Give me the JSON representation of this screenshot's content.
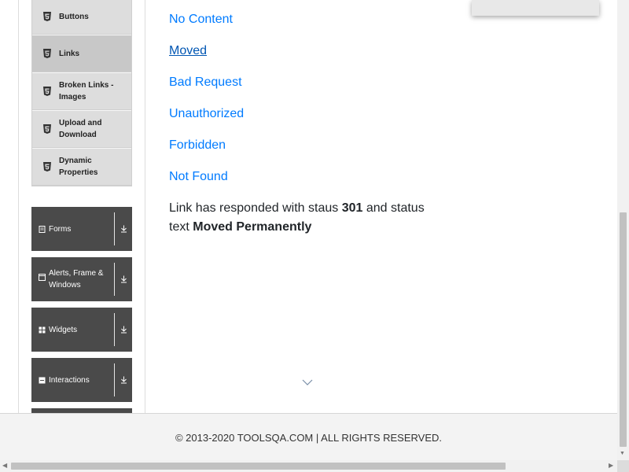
{
  "sidebar": {
    "elements_submenu": [
      {
        "label": "Buttons",
        "icon": "html5-icon",
        "active": false
      },
      {
        "label": "Links",
        "icon": "html5-icon",
        "active": true
      },
      {
        "label": "Broken Links - Images",
        "icon": "html5-icon",
        "active": false
      },
      {
        "label": "Upload and Download",
        "icon": "html5-icon",
        "active": false
      },
      {
        "label": "Dynamic Properties",
        "icon": "html5-icon",
        "active": false
      }
    ],
    "groups": [
      {
        "label": "Forms",
        "icon": "form-icon"
      },
      {
        "label": "Alerts, Frame & Windows",
        "icon": "window-icon"
      },
      {
        "label": "Widgets",
        "icon": "widgets-icon"
      },
      {
        "label": "Interactions",
        "icon": "interactions-icon"
      }
    ]
  },
  "links": [
    {
      "text": "No Content",
      "visited": false
    },
    {
      "text": "Moved",
      "visited": true
    },
    {
      "text": "Bad Request",
      "visited": false
    },
    {
      "text": "Unauthorized",
      "visited": false
    },
    {
      "text": "Forbidden",
      "visited": false
    },
    {
      "text": "Not Found",
      "visited": false
    }
  ],
  "response": {
    "prefix": "Link has responded with staus",
    "status_code": "301",
    "middle": "and status text",
    "status_text": "Moved Permanently"
  },
  "footer": {
    "text": "© 2013-2020 TOOLSQA.COM | ALL RIGHTS RESERVED."
  },
  "colors": {
    "link": "#007bff",
    "link_visited": "#0056b3",
    "group_bg": "#4a4a4a",
    "submenu_bg": "#dddddd",
    "submenu_active_bg": "#c8c8c8"
  }
}
